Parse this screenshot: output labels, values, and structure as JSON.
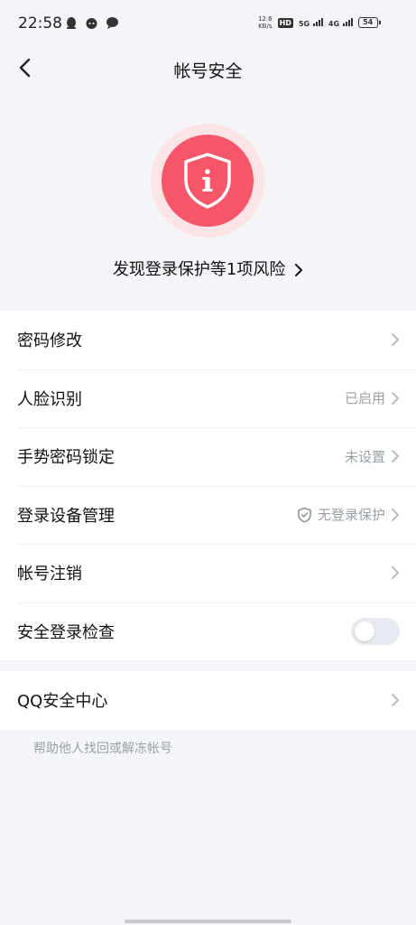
{
  "status_bar": {
    "time": "22:58",
    "speed_top": "12.6",
    "speed_unit": "KB/s",
    "hd_badge": "HD",
    "net1": "5G",
    "net2": "4G",
    "battery": "54"
  },
  "nav": {
    "title": "帐号安全"
  },
  "risk": {
    "text": "发现登录保护等1项风险",
    "color": "#f5566a"
  },
  "settings": {
    "items": [
      {
        "label": "密码修改",
        "value": ""
      },
      {
        "label": "人脸识别",
        "value": "已启用"
      },
      {
        "label": "手势密码锁定",
        "value": "未设置"
      },
      {
        "label": "登录设备管理",
        "value": "无登录保护"
      },
      {
        "label": "帐号注销",
        "value": ""
      },
      {
        "label": "安全登录检查",
        "toggle_on": false
      }
    ]
  },
  "security_center": {
    "label": "QQ安全中心",
    "helper": "帮助他人找回或解冻帐号"
  }
}
